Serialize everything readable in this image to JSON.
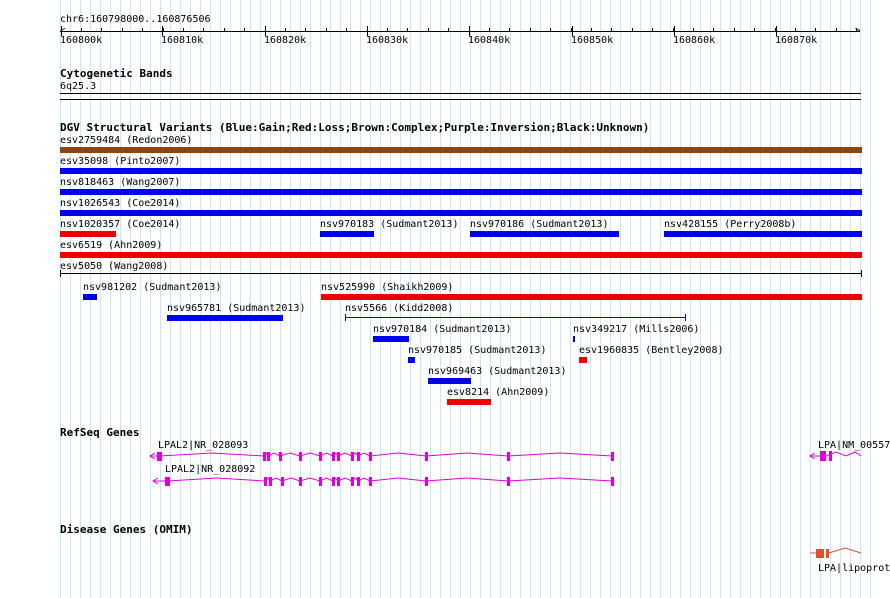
{
  "colors": {
    "gain": "#0000ee",
    "loss": "#ee0000",
    "complex": "#8b4513",
    "unknown": "#000000",
    "refseq": "#dd00dd",
    "omim": "#e05030",
    "grid": "#c9e6f4"
  },
  "ruler": {
    "position": "chr6:160798000..160876506",
    "ticks": [
      "160800k",
      "160810k",
      "160820k",
      "160830k",
      "160840k",
      "160850k",
      "160860k",
      "160870k"
    ]
  },
  "cytoband": {
    "title": "Cytogenetic Bands",
    "band": "6q25.3"
  },
  "dgv": {
    "title": "DGV Structural Variants (Blue:Gain;Red:Loss;Brown:Complex;Purple:Inversion;Black:Unknown)",
    "variants": [
      {
        "label": "esv2759484 (Redon2006)",
        "type": "complex"
      },
      {
        "label": "esv35098 (Pinto2007)",
        "type": "gain"
      },
      {
        "label": "nsv818463 (Wang2007)",
        "type": "gain"
      },
      {
        "label": "nsv1026543 (Coe2014)",
        "type": "gain"
      },
      {
        "label": "nsv1020357 (Coe2014)",
        "type": "loss"
      },
      {
        "label": "nsv970183 (Sudmant2013)",
        "type": "gain"
      },
      {
        "label": "nsv970186 (Sudmant2013)",
        "type": "gain"
      },
      {
        "label": "nsv428155 (Perry2008b)",
        "type": "gain"
      },
      {
        "label": "esv6519 (Ahn2009)",
        "type": "loss"
      },
      {
        "label": "esv5050 (Wang2008)",
        "type": "unknown"
      },
      {
        "label": "nsv981202 (Sudmant2013)",
        "type": "gain"
      },
      {
        "label": "nsv525990 (Shaikh2009)",
        "type": "loss"
      },
      {
        "label": "nsv965781 (Sudmant2013)",
        "type": "gain"
      },
      {
        "label": "nsv5566 (Kidd2008)",
        "type": "gain"
      },
      {
        "label": "nsv970184 (Sudmant2013)",
        "type": "gain"
      },
      {
        "label": "nsv349217 (Mills2006)",
        "type": "gain"
      },
      {
        "label": "nsv970185 (Sudmant2013)",
        "type": "gain"
      },
      {
        "label": "esv1960835 (Bentley2008)",
        "type": "loss"
      },
      {
        "label": "nsv969463 (Sudmant2013)",
        "type": "gain"
      },
      {
        "label": "esv8214 (Ahn2009)",
        "type": "loss"
      }
    ]
  },
  "refseq": {
    "title": "RefSeq Genes",
    "genes": [
      {
        "label": "LPAL2|NR_028093"
      },
      {
        "label": "LPAL2|NR_028092"
      },
      {
        "label": "LPA|NM_00557"
      }
    ]
  },
  "omim": {
    "title": "Disease Genes (OMIM)",
    "genes": [
      {
        "label": "LPA|lipoprot"
      }
    ]
  }
}
